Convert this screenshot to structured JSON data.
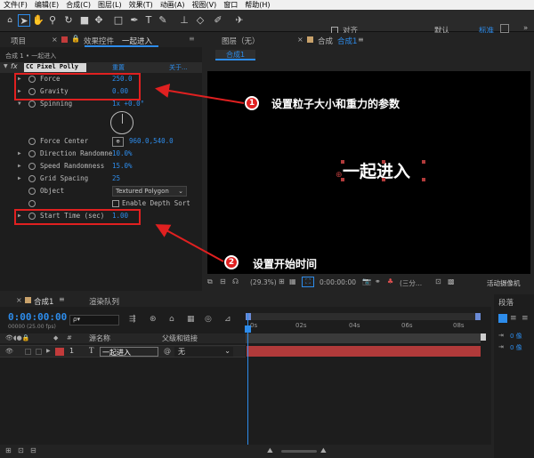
{
  "menubar": [
    "文件(F)",
    "编辑(E)",
    "合成(C)",
    "图层(L)",
    "效果(T)",
    "动画(A)",
    "视图(V)",
    "窗口",
    "帮助(H)"
  ],
  "toolbar": {
    "snap_label": "对齐",
    "workspace_default": "默认",
    "workspace_standard": "标准",
    "more": "»"
  },
  "left_panel": {
    "tab_project": "项目",
    "tab_effects": "效果控件",
    "tab_layer": "一起进入",
    "breadcrumb": "合成 1 • 一起进入",
    "effect_name": "CC Pixel Polly",
    "reset": "重置",
    "about": "关于...",
    "properties": [
      {
        "name": "Force",
        "value": "250.0"
      },
      {
        "name": "Gravity",
        "value": "0.00"
      },
      {
        "name": "Spinning",
        "value": "1x +0.0°"
      },
      {
        "name": "Force Center",
        "value": "960.0,540.0"
      },
      {
        "name": "Direction Randomne",
        "value": "10.0%"
      },
      {
        "name": "Speed Randomness",
        "value": "15.0%"
      },
      {
        "name": "Grid Spacing",
        "value": "25"
      },
      {
        "name": "Object",
        "value": "Textured Polygon"
      },
      {
        "name": "Enable Depth Sort",
        "value": ""
      },
      {
        "name": "Start Time (sec)",
        "value": "1.00"
      }
    ]
  },
  "viewer": {
    "tab_layer": "图层（无）",
    "tab_comp_prefix": "合成",
    "tab_comp_name": "合成1",
    "sub_tab": "合成1",
    "comp_text": "一起进入",
    "zoom": "(29.3%)",
    "timecode": "0:00:00:00",
    "resolution": "(三分...",
    "camera": "活动摄像机"
  },
  "annotations": [
    {
      "number": "1",
      "text": "设置粒子大小和重力的参数"
    },
    {
      "number": "2",
      "text": "设置开始时间"
    }
  ],
  "timeline": {
    "tab_comp": "合成1",
    "tab_render": "渲染队列",
    "timecode": "0:00:00:00",
    "fps": "00000 (25.00 fps)",
    "search_placeholder": "ρ▾",
    "col_source": "源名称",
    "col_parent": "父级和链接",
    "ruler": [
      "0s",
      "02s",
      "04s",
      "06s",
      "08s"
    ],
    "layer": {
      "num": "1",
      "type": "T",
      "name": "一起进入",
      "parent": "无"
    }
  },
  "right_panel": {
    "title": "段落",
    "val1": "0 像",
    "val2": "0 像"
  },
  "colors": {
    "accent": "#2d8ceb",
    "annotation": "#e02020",
    "layer_bar": "#b13a3a",
    "label": "#c23b3b"
  }
}
